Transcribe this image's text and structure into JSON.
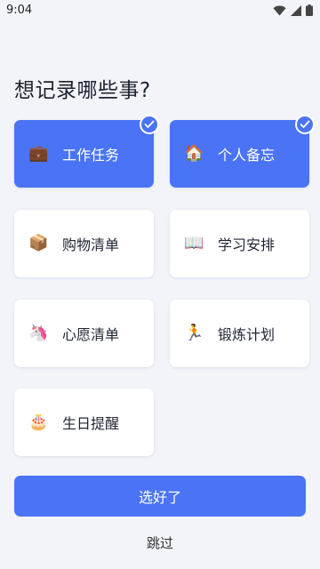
{
  "status_bar": {
    "time": "9:04",
    "icons": [
      "wifi-icon",
      "signal-icon",
      "battery-icon"
    ]
  },
  "title": "想记录哪些事?",
  "options": [
    {
      "label": "工作任务",
      "icon": "💼",
      "icon_name": "briefcase-icon",
      "selected": true
    },
    {
      "label": "个人备忘",
      "icon": "🏠",
      "icon_name": "house-icon",
      "selected": true
    },
    {
      "label": "购物清单",
      "icon": "📦",
      "icon_name": "package-icon",
      "selected": false
    },
    {
      "label": "学习安排",
      "icon": "📖",
      "icon_name": "book-icon",
      "selected": false
    },
    {
      "label": "心愿清单",
      "icon": "🦄",
      "icon_name": "unicorn-icon",
      "selected": false
    },
    {
      "label": "锻炼计划",
      "icon": "🏃",
      "icon_name": "runner-icon",
      "selected": false
    },
    {
      "label": "生日提醒",
      "icon": "🎂",
      "icon_name": "birthday-cake-icon",
      "selected": false
    }
  ],
  "done_button": "选好了",
  "skip_link": "跳过",
  "colors": {
    "accent": "#4a74f5",
    "background": "#f2f4fa",
    "card": "#ffffff"
  }
}
